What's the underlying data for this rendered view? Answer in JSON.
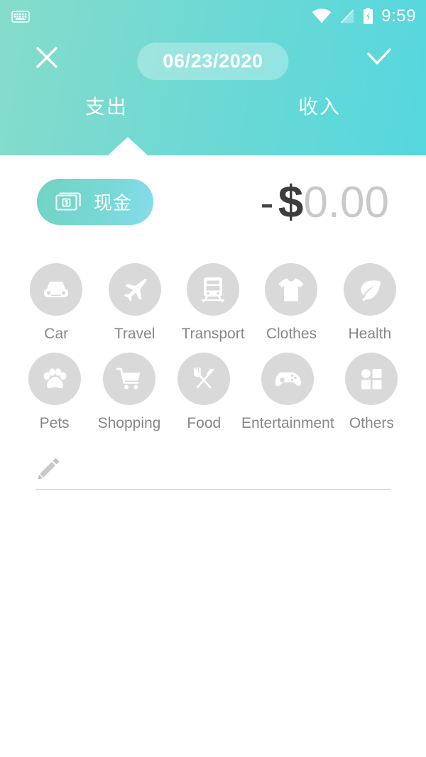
{
  "status_bar": {
    "keyboard_icon": "keyboard-icon",
    "wifi_icon": "wifi-icon",
    "signal_icon": "signal-off-icon",
    "battery_icon": "battery-charging-icon",
    "time": "9:59"
  },
  "header": {
    "close_icon": "close-icon",
    "confirm_icon": "check-icon",
    "date": "06/23/2020",
    "tabs": [
      {
        "label": "支出",
        "name": "tab-expense",
        "active": true
      },
      {
        "label": "收入",
        "name": "tab-income",
        "active": false
      }
    ],
    "gradient_start": "#86dccb",
    "gradient_end": "#55d7de"
  },
  "entry": {
    "account": {
      "icon": "banknote-dollar-icon",
      "label": "现金"
    },
    "amount": {
      "sign": "-",
      "currency": "$",
      "value": "0.00"
    }
  },
  "categories": {
    "row1": [
      {
        "label": "Car",
        "icon": "car-icon",
        "name": "category-car"
      },
      {
        "label": "Travel",
        "icon": "airplane-icon",
        "name": "category-travel"
      },
      {
        "label": "Transport",
        "icon": "train-icon",
        "name": "category-transport"
      },
      {
        "label": "Clothes",
        "icon": "tshirt-icon",
        "name": "category-clothes"
      },
      {
        "label": "Health",
        "icon": "leaf-icon",
        "name": "category-health"
      }
    ],
    "row2": [
      {
        "label": "Pets",
        "icon": "paw-icon",
        "name": "category-pets"
      },
      {
        "label": "Shopping",
        "icon": "cart-icon",
        "name": "category-shopping"
      },
      {
        "label": "Food",
        "icon": "cutlery-icon",
        "name": "category-food"
      },
      {
        "label": "Entertainment",
        "icon": "gamepad-icon",
        "name": "category-entertainment"
      },
      {
        "label": "Others",
        "icon": "grid-icon",
        "name": "category-others"
      }
    ],
    "circle_color": "#d9d9d9",
    "label_color": "#878787"
  },
  "note": {
    "icon": "pencil-icon",
    "value": "",
    "placeholder": ""
  }
}
